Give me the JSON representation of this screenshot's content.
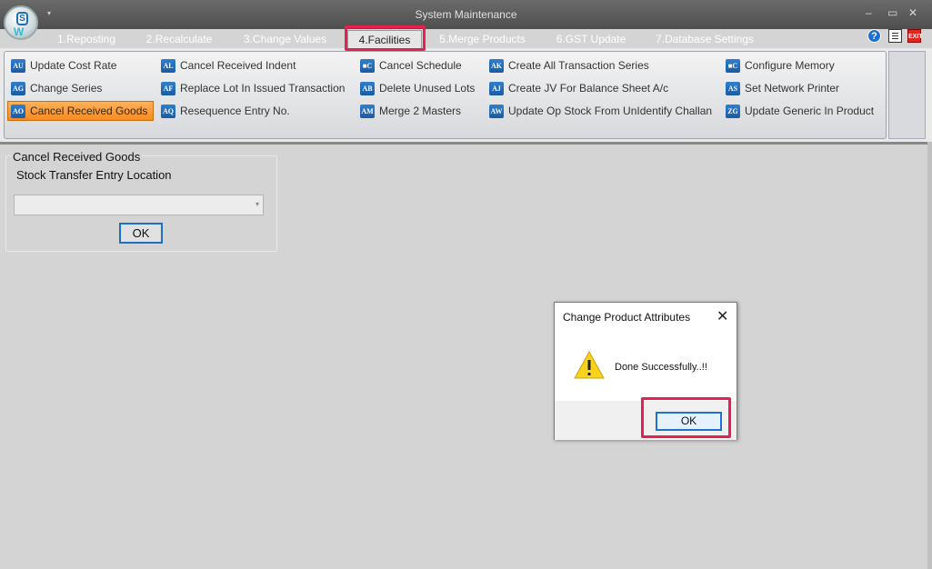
{
  "window": {
    "title": "System Maintenance"
  },
  "tabs": [
    {
      "label": "1.Reposting"
    },
    {
      "label": "2.Recalculate"
    },
    {
      "label": "3.Change Values"
    },
    {
      "label": "4.Facilities",
      "active": true
    },
    {
      "label": "5.Merge Products"
    },
    {
      "label": "6.GST Update"
    },
    {
      "label": "7.Database Settings"
    }
  ],
  "ribbon": {
    "col1": [
      {
        "label": "Update Cost Rate",
        "icon_text": "AU"
      },
      {
        "label": "Change Series",
        "icon_text": "AG"
      },
      {
        "label": "Cancel Received Goods",
        "icon_text": "AO",
        "selected": true
      }
    ],
    "col2": [
      {
        "label": "Cancel Received Indent",
        "icon_text": "AL"
      },
      {
        "label": "Replace Lot In Issued Transaction",
        "icon_text": "AF"
      },
      {
        "label": "Resequence Entry No.",
        "icon_text": "AQ"
      }
    ],
    "col3": [
      {
        "label": "Cancel Schedule",
        "icon_text": "■C"
      },
      {
        "label": "Delete Unused Lots",
        "icon_text": "AB"
      },
      {
        "label": "Merge 2 Masters",
        "icon_text": "AM"
      }
    ],
    "col4": [
      {
        "label": "Create All Transaction Series",
        "icon_text": "AK"
      },
      {
        "label": "Create JV For Balance Sheet A/c",
        "icon_text": "AJ"
      },
      {
        "label": "Update Op Stock From UnIdentify Challan",
        "icon_text": "AW"
      }
    ],
    "col5": [
      {
        "label": "Configure Memory",
        "icon_text": "■C"
      },
      {
        "label": "Set Network Printer",
        "icon_text": "AS"
      },
      {
        "label": "Update Generic In Product",
        "icon_text": "ZG"
      }
    ]
  },
  "panel": {
    "title": "Cancel Received Goods",
    "label": "Stock Transfer Entry Location",
    "combo_value": "",
    "ok_label": "OK"
  },
  "dialog": {
    "title": "Change Product Attributes",
    "message": "Done Successfully..!!",
    "ok_label": "OK",
    "close_glyph": "✕"
  },
  "controls": {
    "help_glyph": "?",
    "exit_label": "EXIT",
    "minimize": "–",
    "maximize": "▭",
    "close": "✕",
    "dropdown_arrow": "▾"
  },
  "colors": {
    "highlight": "#e8204f",
    "selected_item": "#f58a1f",
    "focus_blue": "#1d6fc1"
  },
  "icons": [
    "app-logo-icon",
    "warning-icon",
    "help-icon",
    "notes-icon",
    "exit-icon"
  ]
}
